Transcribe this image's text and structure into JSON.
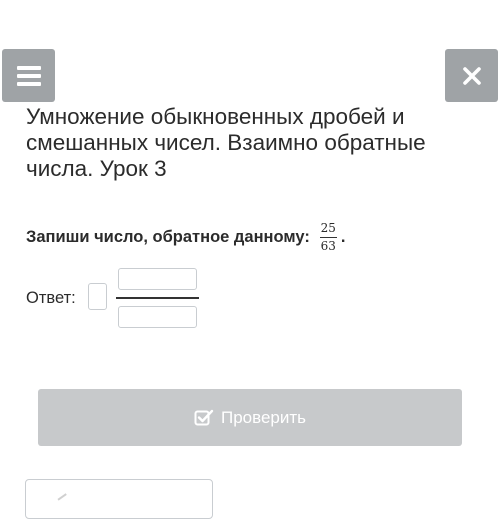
{
  "header": {
    "title": "Умножение обыкновенных дробей и смешанных чисел. Взаимно обратные числа. Урок 3"
  },
  "task": {
    "prompt": "Запиши число, обратное данному:",
    "fraction_numerator": "25",
    "fraction_denominator": "63",
    "end_punct": "."
  },
  "answer": {
    "label": "Ответ:",
    "whole_value": "",
    "numerator_value": "",
    "denominator_value": ""
  },
  "actions": {
    "check_label": "Проверить",
    "check_icon": "check-square-icon"
  },
  "colors": {
    "icon_button_bg": "#9fa3a6",
    "disabled_button_bg": "#c7c9cb"
  }
}
